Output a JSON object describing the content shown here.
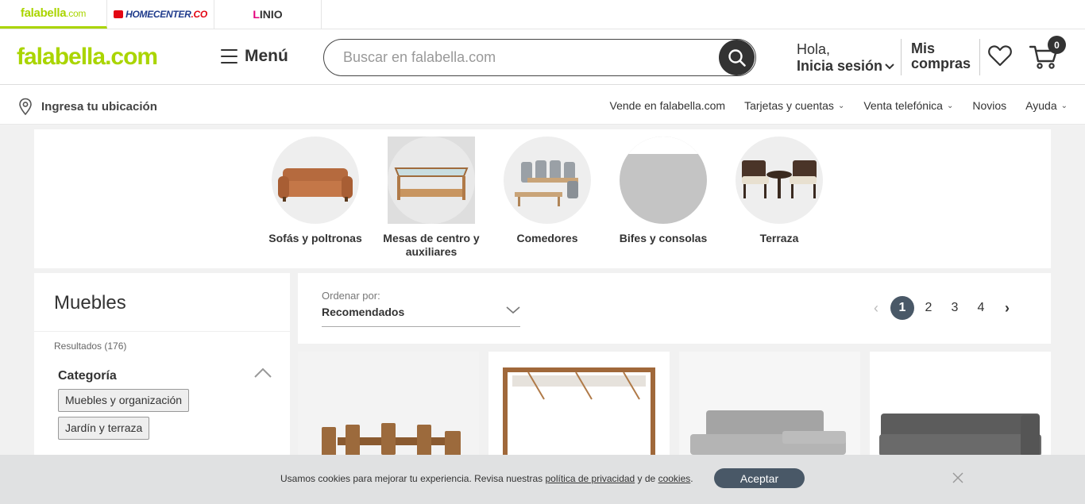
{
  "brands": {
    "falabella": "falabella",
    "falabella_suffix": ".com",
    "homecenter": "HOMECENTER",
    "homecenter_suffix": ".CO",
    "linio": "INIO",
    "linio_l": "L"
  },
  "header": {
    "logo": "falabella",
    "logo_suffix": ".com",
    "menu_label": "Menú",
    "search_placeholder": "Buscar en falabella.com",
    "account_line1": "Hola,",
    "account_line2": "Inicia sesión",
    "purchases_line1": "Mis",
    "purchases_line2": "compras",
    "cart_count": "0"
  },
  "locbar": {
    "location_label": "Ingresa tu ubicación",
    "nav": [
      {
        "label": "Vende en falabella.com",
        "caret": false
      },
      {
        "label": "Tarjetas y cuentas",
        "caret": true
      },
      {
        "label": "Venta telefónica",
        "caret": true
      },
      {
        "label": "Novios",
        "caret": false
      },
      {
        "label": "Ayuda",
        "caret": true
      }
    ]
  },
  "categories": [
    {
      "label": "Sofás y poltronas"
    },
    {
      "label": "Mesas de centro y auxiliares"
    },
    {
      "label": "Comedores"
    },
    {
      "label": "Bifes y consolas"
    },
    {
      "label": "Terraza"
    }
  ],
  "filters": {
    "title": "Muebles",
    "results": "Resultados (176)",
    "category_heading": "Categoría",
    "chips": [
      "Muebles y organización",
      "Jardín y terraza"
    ]
  },
  "sort": {
    "label": "Ordenar por:",
    "value": "Recomendados"
  },
  "pagination": {
    "pages": [
      "1",
      "2",
      "3",
      "4"
    ],
    "current": "1",
    "prev": "‹",
    "next": "›"
  },
  "cookie": {
    "text_before": "Usamos cookies para mejorar tu experiencia. Revisa nuestras ",
    "privacy_link": "política de privacidad",
    "text_middle": " y de ",
    "cookies_link": "cookies",
    "text_after": ".",
    "accept_label": "Aceptar"
  },
  "colors": {
    "brand_green": "#aad500",
    "dark_button": "#495867"
  }
}
